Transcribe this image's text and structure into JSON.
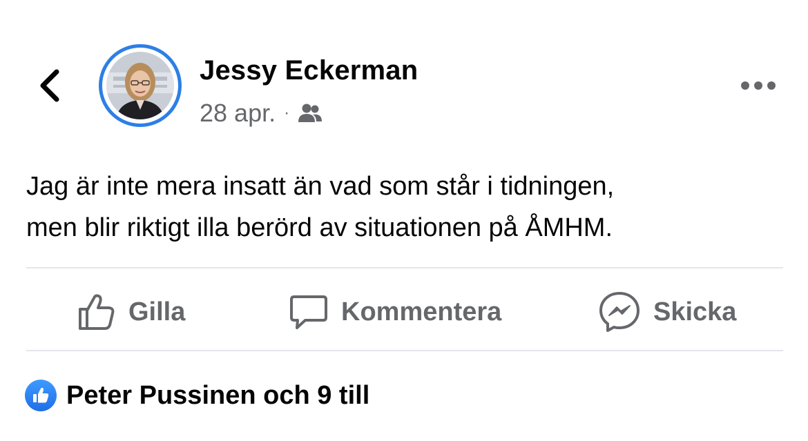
{
  "header": {
    "back_icon": "chevron-left-icon",
    "author_name": "Jessy Eckerman",
    "date": "28 apr.",
    "separator": "·",
    "audience_icon": "friends-icon",
    "more_icon": "ellipsis-icon"
  },
  "post": {
    "lines": [
      "Jag är inte mera insatt än vad som står i tidningen,",
      "men blir riktigt illa berörd av situationen på ÅMHM."
    ]
  },
  "actions": [
    {
      "label": "Gilla",
      "icon": "thumbs-up-icon"
    },
    {
      "label": "Kommentera",
      "icon": "comment-icon"
    },
    {
      "label": "Skicka",
      "icon": "messenger-icon"
    }
  ],
  "reactions": {
    "icon": "like-badge-icon",
    "summary": "Peter Pussinen och 9 till"
  },
  "colors": {
    "accent": "#2d7fe6",
    "secondary_text": "#65676b",
    "divider": "#e4e6eb"
  }
}
